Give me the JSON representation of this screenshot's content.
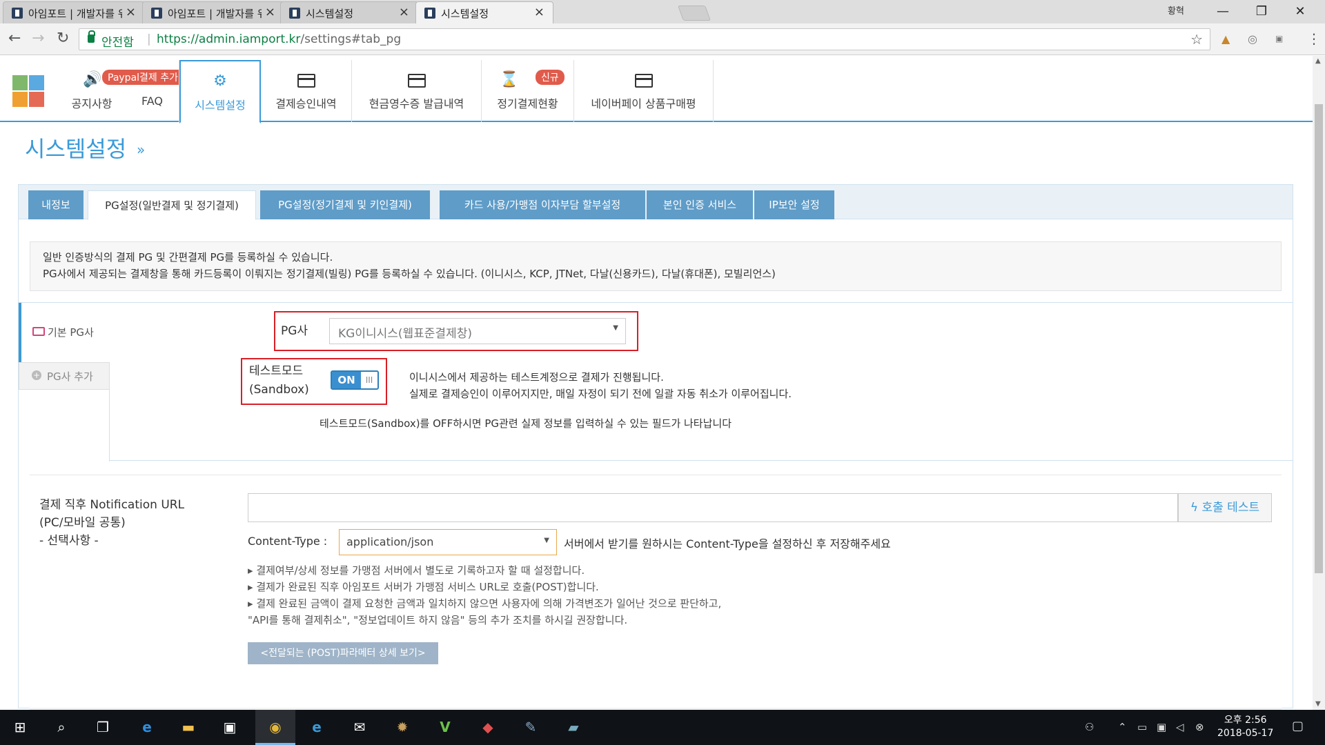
{
  "browser": {
    "tabs": [
      {
        "title": "아임포트 | 개발자를 위한",
        "active": false
      },
      {
        "title": "아임포트 | 개발자를 위한",
        "active": false
      },
      {
        "title": "시스템설정",
        "active": false
      },
      {
        "title": "시스템설정",
        "active": true
      }
    ],
    "close_glyph": "×",
    "profile_label": "황혁",
    "window_controls": {
      "minimize": "—",
      "maximize": "❐",
      "close": "✕"
    },
    "security_label": "안전함",
    "url_host": "https://admin.iamport.kr",
    "url_path": "/settings#tab_pg",
    "icons": [
      "back-icon",
      "forward-icon",
      "reload-icon",
      "lock-icon",
      "star-icon",
      "menu-icon"
    ]
  },
  "site_nav": {
    "items": [
      {
        "label": "공지사항",
        "icon": "speaker-icon",
        "badge": "Paypal결제 추가!"
      },
      {
        "label": "FAQ"
      },
      {
        "label": "시스템설정",
        "icon": "gear-icon",
        "active": true
      },
      {
        "label": "결제승인내역",
        "icon": "card-icon"
      },
      {
        "label": "현금영수증 발급내역",
        "icon": "card-icon"
      },
      {
        "label": "정기결제현황",
        "icon": "hourglass-icon",
        "badge": "신규"
      },
      {
        "label": "네이버페이 상품구매평",
        "icon": "card-icon"
      }
    ],
    "accent_color": "#3a9ad9"
  },
  "page": {
    "title": "시스템설정",
    "title_chevron": "»"
  },
  "settings_tabs": [
    {
      "label": "내정보"
    },
    {
      "label": "PG설정(일반결제 및 정기결제)",
      "active": true
    },
    {
      "label": "PG설정(정기결제 및 키인결제)"
    },
    {
      "label": "카드 사용/가맹점 이자부담 할부설정"
    },
    {
      "label": "본인 인증 서비스"
    },
    {
      "label": "IP보안 설정"
    }
  ],
  "info": {
    "line1": "일반 인증방식의 결제 PG 및 간편결제 PG를 등록하실 수 있습니다.",
    "line2": "PG사에서 제공되는 결제창을 통해 카드등록이 이뤄지는 정기결제(빌링) PG를 등록하실 수 있습니다. (이니시스, KCP, JTNet, 다날(신용카드), 다날(휴대폰), 모빌리언스)"
  },
  "pg": {
    "default_label": "기본 PG사",
    "add_label": "PG사 추가",
    "select_label": "PG사",
    "select_value": "KG이니시스(웹표준결제창)",
    "test_mode_label_1": "테스트모드",
    "test_mode_label_2": "(Sandbox)",
    "toggle_state": "ON",
    "toggle_handle": "III",
    "test_desc_1": "이니시스에서 제공하는 테스트계정으로 결제가 진행됩니다.",
    "test_desc_2": "실제로 결제승인이 이루어지지만, 매일 자정이 되기 전에 일괄 자동 취소가 이루어집니다.",
    "off_hint": "테스트모드(Sandbox)를 OFF하시면 PG관련 실제 정보를 입력하실 수 있는 필드가 나타납니다",
    "highlight_color": "#d81f26"
  },
  "notification": {
    "label_1": "결제 직후 Notification URL",
    "label_2": "(PC/모바일 공통)",
    "label_3": "- 선택사항 -",
    "url_value": "",
    "call_test_label": "호출 테스트",
    "content_type_label": "Content-Type :",
    "content_type_value": "application/json",
    "content_type_hint": "서버에서 받기를 원하시는 Content-Type을 설정하신 후 저장해주세요",
    "bullets": [
      "결제여부/상세 정보를 가맹점 서버에서 별도로 기록하고자 할 때 설정합니다.",
      "결제가 완료된 직후 아임포트 서버가 가맹점 서비스 URL로 호출(POST)합니다.",
      "결제 완료된 금액이 결제 요청한 금액과 일치하지 않으면 사용자에 의해 가격변조가 일어난 것으로 판단하고,"
    ],
    "bullet_continuation": "\"API를 통해 결제취소\", \"정보업데이트 하지 않음\" 등의 추가 조치를 하시길 권장합니다.",
    "params_button": "<전달되는 (POST)파라메터 상세 보기>"
  },
  "taskbar": {
    "time": "오후 2:56",
    "date": "2018-05-17",
    "apps": [
      "windows-start-icon",
      "search-icon",
      "task-view-icon",
      "edge-icon",
      "file-explorer-icon",
      "store-icon",
      "chrome-icon",
      "ie-icon",
      "mail-icon",
      "settings-app-icon",
      "vim-icon",
      "app-icon",
      "paint-icon",
      "book-icon"
    ]
  }
}
